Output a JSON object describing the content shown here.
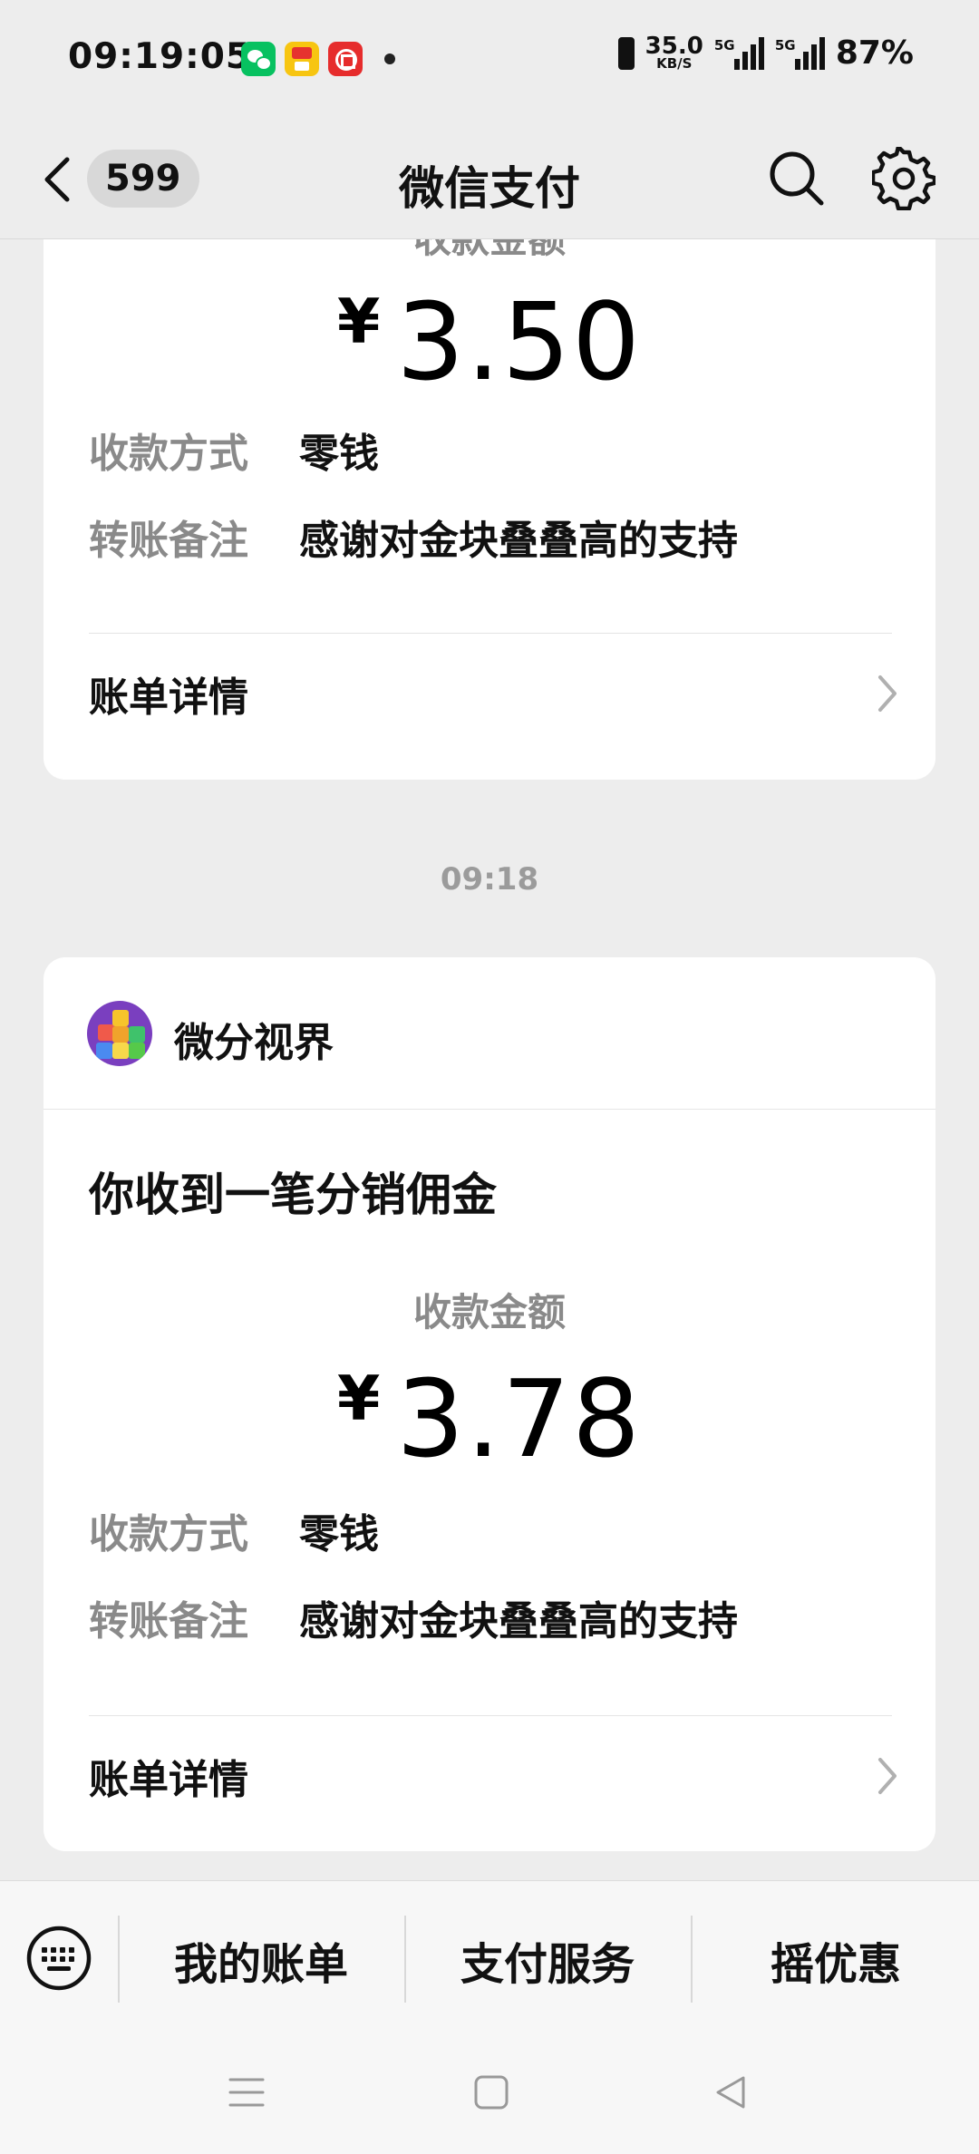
{
  "status_bar": {
    "time": "09:19:05",
    "net_speed": "35.0",
    "net_unit": "KB/S",
    "sim1": "5G",
    "sim2": "5G",
    "battery": "87%",
    "apps": [
      "wechat-icon",
      "coupon-app-icon",
      "bank-app-icon"
    ]
  },
  "nav": {
    "unread": "599",
    "title": "微信支付"
  },
  "card1": {
    "amount_label": "收款金额",
    "currency": "¥",
    "amount": "3.50",
    "method_label": "收款方式",
    "method_value": "零钱",
    "note_label": "转账备注",
    "note_value": "感谢对金块叠叠高的支持",
    "bill_link": "账单详情"
  },
  "timestamp": "09:18",
  "card2": {
    "merchant": "微分视界",
    "title": "你收到一笔分销佣金",
    "amount_label": "收款金额",
    "currency": "¥",
    "amount": "3.78",
    "method_label": "收款方式",
    "method_value": "零钱",
    "note_label": "转账备注",
    "note_value": "感谢对金块叠叠高的支持",
    "bill_link": "账单详情"
  },
  "bottom_menu": {
    "items": [
      "我的账单",
      "支付服务",
      "摇优惠"
    ]
  },
  "colors": {
    "background": "#ededed",
    "card": "#ffffff",
    "muted_text": "#8a8a8a",
    "wechat_green": "#07c160"
  }
}
